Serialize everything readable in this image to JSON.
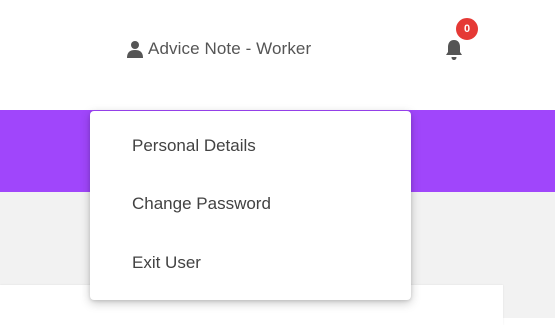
{
  "header": {
    "user_menu": {
      "icon": "user-icon",
      "label": "Advice Note - Worker"
    },
    "notifications": {
      "icon": "bell-icon",
      "count": "0",
      "badge_color": "#e53935"
    }
  },
  "theme": {
    "accent": "#a046fb",
    "background": "#f2f2f2"
  },
  "user_dropdown": {
    "items": [
      {
        "label": "Personal Details"
      },
      {
        "label": "Change Password"
      },
      {
        "label": "Exit User"
      }
    ]
  }
}
